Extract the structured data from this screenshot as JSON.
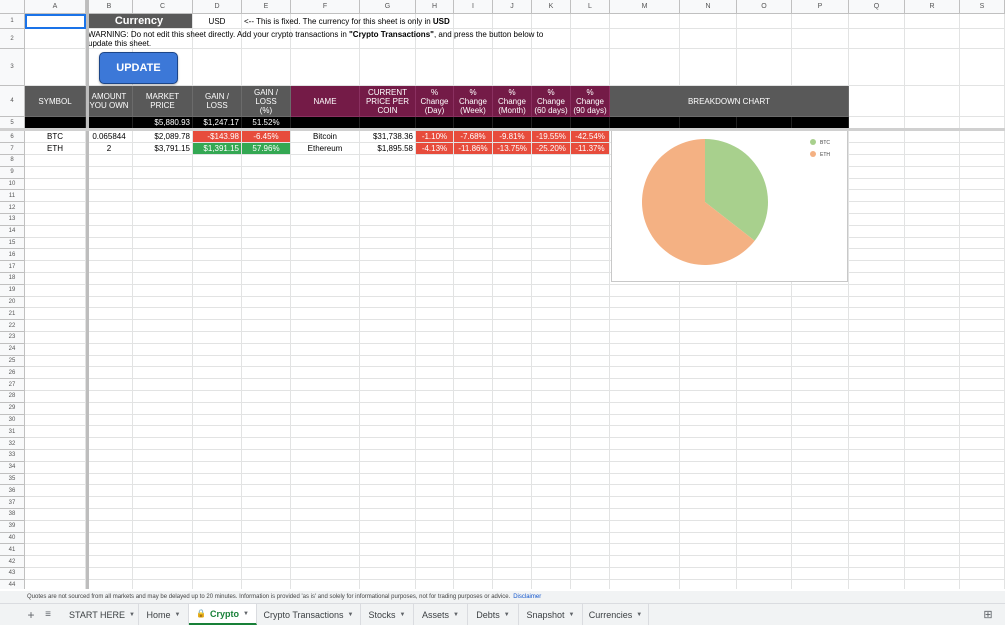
{
  "columns": [
    "A",
    "B",
    "C",
    "D",
    "E",
    "F",
    "G",
    "H",
    "I",
    "J",
    "K",
    "L",
    "M",
    "N",
    "O",
    "P",
    "Q",
    "R",
    "S"
  ],
  "header_area": {
    "currency_label": "Currency",
    "currency_value": "USD",
    "currency_note_prefix": "<-- This is fixed. The currency for this sheet is only in ",
    "currency_note_bold": "USD",
    "warning_line1_prefix": "WARNING: Do not edit this sheet directly. Add your crypto transactions in ",
    "warning_line1_bold": "\"Crypto Transactions\"",
    "warning_line1_suffix": ", and press the button below to",
    "warning_line2": "update this sheet.",
    "update_button": "UPDATE"
  },
  "table": {
    "headers": {
      "symbol": "SYMBOL",
      "amount_1": "AMOUNT",
      "amount_2": "YOU OWN",
      "market_price": "MARKET PRICE",
      "gain_loss": "GAIN / LOSS",
      "gain_loss_pct_1": "GAIN / LOSS",
      "gain_loss_pct_2": "(%)",
      "name": "NAME",
      "current_price_1": "CURRENT",
      "current_price_2": "PRICE PER",
      "current_price_3": "COIN",
      "day_1": "% Change",
      "day_2": "(Day)",
      "week_1": "% Change",
      "week_2": "(Week)",
      "month_1": "% Change",
      "month_2": "(Month)",
      "d60_1": "% Change",
      "d60_2": "(60 days)",
      "d90_1": "% Change",
      "d90_2": "(90 days)",
      "breakdown": "BREAKDOWN CHART"
    },
    "totals": {
      "market_price": "$5,880.93",
      "gain_loss": "$1,247.17",
      "gain_loss_pct": "51.52%"
    },
    "rows": [
      {
        "symbol": "BTC",
        "amount": "0.065844",
        "market_price": "$2,089.78",
        "gain_loss": "-$143.98",
        "gain_loss_pct": "-6.45%",
        "name": "Bitcoin",
        "current_price": "$31,738.36",
        "day": "-1.10%",
        "week": "-7.68%",
        "month": "-9.81%",
        "d60": "-19.55%",
        "d90": "-42.54%"
      },
      {
        "symbol": "ETH",
        "amount": "2",
        "market_price": "$3,791.15",
        "gain_loss": "$1,391.15",
        "gain_loss_pct": "57.96%",
        "name": "Ethereum",
        "current_price": "$1,895.58",
        "day": "-4.13%",
        "week": "-11.86%",
        "month": "-13.75%",
        "d60": "-25.20%",
        "d90": "-11.37%"
      }
    ]
  },
  "chart_data": {
    "type": "pie",
    "categories": [
      "BTC",
      "ETH"
    ],
    "values": [
      2089.78,
      3791.15
    ],
    "colors": [
      "#a8d08d",
      "#f4b183"
    ],
    "title": "",
    "legend": "top-right"
  },
  "footer": {
    "note": "Quotes are not sourced from all markets and may be delayed up to 20 minutes. Information is provided 'as is' and solely for informational purposes, not for trading purposes or advice.",
    "disclaimer": "Disclaimer"
  },
  "tabs": [
    {
      "label": "START HERE",
      "active": false
    },
    {
      "label": "Home",
      "active": false
    },
    {
      "label": "Crypto",
      "active": true
    },
    {
      "label": "Crypto Transactions",
      "active": false
    },
    {
      "label": "Stocks",
      "active": false
    },
    {
      "label": "Assets",
      "active": false
    },
    {
      "label": "Debts",
      "active": false
    },
    {
      "label": "Snapshot",
      "active": false
    },
    {
      "label": "Currencies",
      "active": false
    }
  ],
  "colors": {
    "header_dark": "#595959",
    "header_maroon": "#741b47",
    "loss_red": "#e74c3c",
    "gain_green": "#34a853",
    "button_blue": "#3c78d8",
    "active_tab": "#188038"
  }
}
